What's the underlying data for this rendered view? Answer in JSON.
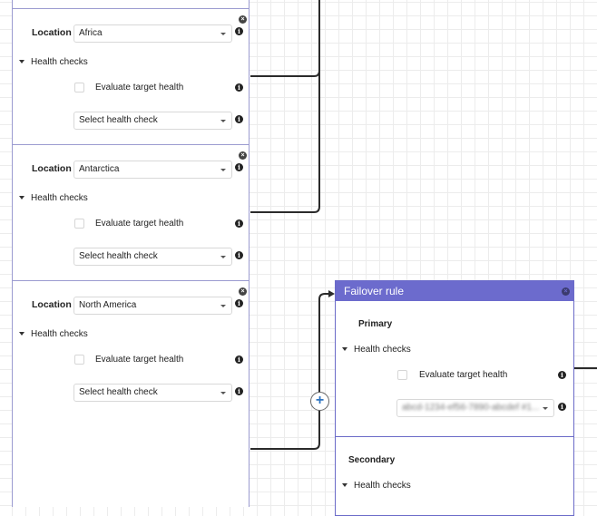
{
  "location_rules": [
    {
      "location_label": "Location",
      "location_value": "Africa",
      "health_checks_label": "Health checks",
      "evaluate_target_health_label": "Evaluate target health",
      "evaluate_target_health_checked": false,
      "health_check_placeholder": "Select health check"
    },
    {
      "location_label": "Location",
      "location_value": "Antarctica",
      "health_checks_label": "Health checks",
      "evaluate_target_health_label": "Evaluate target health",
      "evaluate_target_health_checked": false,
      "health_check_placeholder": "Select health check"
    },
    {
      "location_label": "Location",
      "location_value": "North America",
      "health_checks_label": "Health checks",
      "evaluate_target_health_label": "Evaluate target health",
      "evaluate_target_health_checked": false,
      "health_check_placeholder": "Select health check"
    }
  ],
  "failover_rule": {
    "title": "Failover rule",
    "primary": {
      "title": "Primary",
      "health_checks_label": "Health checks",
      "evaluate_target_health_label": "Evaluate target health",
      "evaluate_target_health_checked": false,
      "health_check_value": "abcd-1234-ef56-7890-abcdef #1..."
    },
    "secondary": {
      "title": "Secondary",
      "health_checks_label": "Health checks"
    }
  },
  "icons": {
    "info": "i",
    "close": "×",
    "add": "+"
  },
  "colors": {
    "accent": "#6c6bcd",
    "panel_border": "#9b9bd0",
    "add_icon": "#2f74c0"
  }
}
